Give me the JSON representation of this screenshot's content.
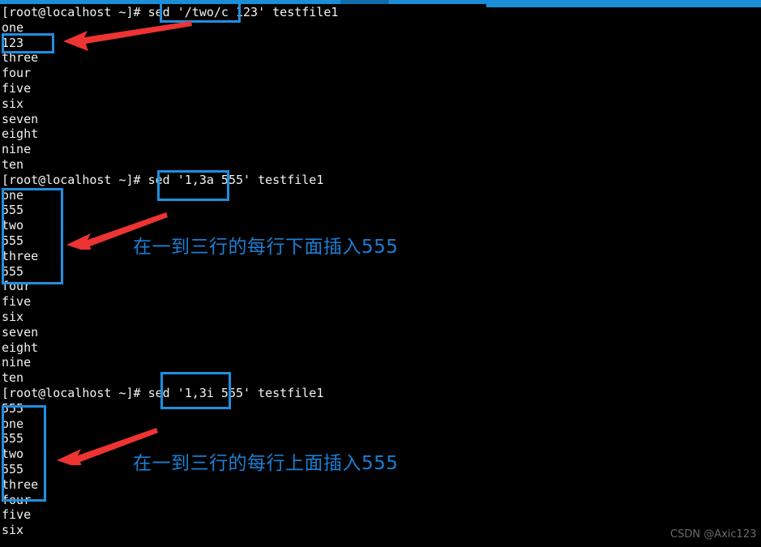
{
  "window": {
    "chrome_visible": true,
    "background": "#000000",
    "accent": "#1f8fe0",
    "arrow_color": "#ee3333",
    "text_color": "#f2f2f2"
  },
  "terminal": {
    "prompt": "[root@localhost ~]# ",
    "lines": [
      {
        "type": "prompt",
        "command": "sed '/two/c 123' testfile1"
      },
      {
        "type": "output",
        "text": "one"
      },
      {
        "type": "output",
        "text": "123"
      },
      {
        "type": "output",
        "text": "three"
      },
      {
        "type": "output",
        "text": "four"
      },
      {
        "type": "output",
        "text": "five"
      },
      {
        "type": "output",
        "text": "six"
      },
      {
        "type": "output",
        "text": "seven"
      },
      {
        "type": "output",
        "text": "eight"
      },
      {
        "type": "output",
        "text": "nine"
      },
      {
        "type": "output",
        "text": "ten"
      },
      {
        "type": "prompt",
        "command": "sed '1,3a 555' testfile1"
      },
      {
        "type": "output",
        "text": "one"
      },
      {
        "type": "output",
        "text": "555"
      },
      {
        "type": "output",
        "text": "two"
      },
      {
        "type": "output",
        "text": "555"
      },
      {
        "type": "output",
        "text": "three"
      },
      {
        "type": "output",
        "text": "555"
      },
      {
        "type": "output",
        "text": "four"
      },
      {
        "type": "output",
        "text": "five"
      },
      {
        "type": "output",
        "text": "six"
      },
      {
        "type": "output",
        "text": "seven"
      },
      {
        "type": "output",
        "text": "eight"
      },
      {
        "type": "output",
        "text": "nine"
      },
      {
        "type": "output",
        "text": "ten"
      },
      {
        "type": "prompt",
        "command": "sed '1,3i 555' testfile1"
      },
      {
        "type": "output",
        "text": "555"
      },
      {
        "type": "output",
        "text": "one"
      },
      {
        "type": "output",
        "text": "555"
      },
      {
        "type": "output",
        "text": "two"
      },
      {
        "type": "output",
        "text": "555"
      },
      {
        "type": "output",
        "text": "three"
      },
      {
        "type": "output",
        "text": "four"
      },
      {
        "type": "output",
        "text": "five"
      },
      {
        "type": "output",
        "text": "six"
      }
    ],
    "rendered": [
      "[root@localhost ~]# sed '/two/c 123' testfile1",
      "one",
      "123",
      "three",
      "four",
      "five",
      "six",
      "seven",
      "eight",
      "nine",
      "ten",
      "[root@localhost ~]# sed '1,3a 555' testfile1",
      "one",
      "555",
      "two",
      "555",
      "three",
      "555",
      "four",
      "five",
      "six",
      "seven",
      "eight",
      "nine",
      "ten",
      "[root@localhost ~]# sed '1,3i 555' testfile1",
      "555",
      "one",
      "555",
      "two",
      "555",
      "three",
      "four",
      "five",
      "six"
    ]
  },
  "annotations": {
    "captions": [
      {
        "id": "caption-append",
        "text": "在一到三行的每行下面插入555"
      },
      {
        "id": "caption-insert",
        "text": "在一到三行的每行上面插入555"
      }
    ],
    "highlight_boxes": [
      {
        "id": "box-cmd-change",
        "target": "'/two/c 123'"
      },
      {
        "id": "box-out-change",
        "target": "123"
      },
      {
        "id": "box-cmd-append",
        "target": "'1,3a 555'"
      },
      {
        "id": "box-out-append",
        "target": "one 555 two 555 three 555"
      },
      {
        "id": "box-cmd-insert",
        "target": "'1,3i 555'"
      },
      {
        "id": "box-out-insert",
        "target": "555 one 555 two 555 three"
      }
    ],
    "arrows": [
      {
        "id": "arrow-change",
        "from": "box-cmd-change",
        "to": "box-out-change"
      },
      {
        "id": "arrow-append",
        "from": "caption-append",
        "to": "box-out-append"
      },
      {
        "id": "arrow-insert",
        "from": "caption-insert",
        "to": "box-out-insert"
      }
    ]
  },
  "watermark": {
    "text": "CSDN @Axic123"
  }
}
